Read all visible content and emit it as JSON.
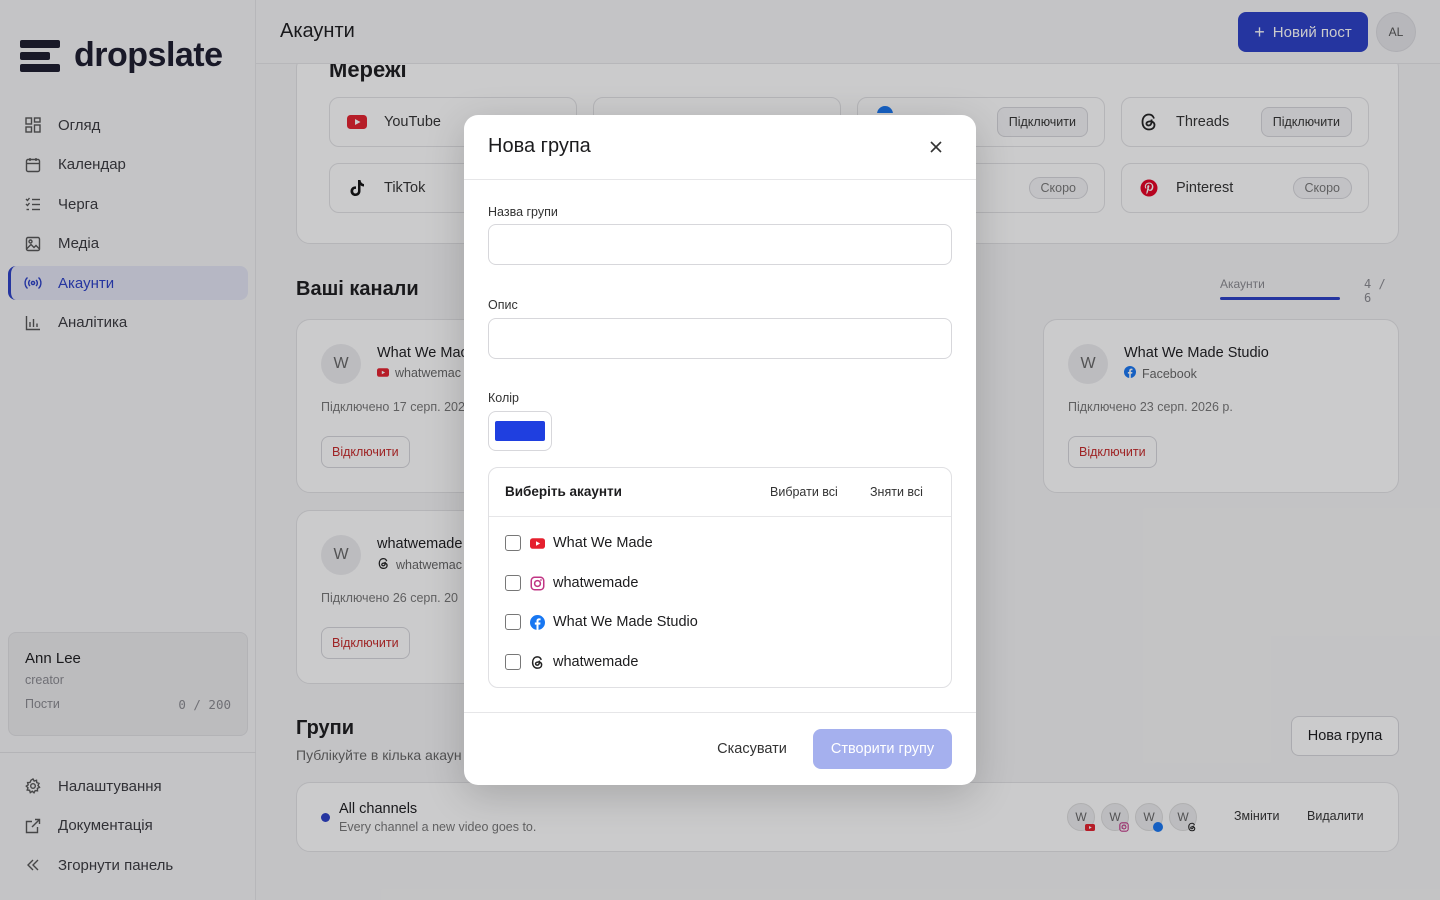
{
  "app": {
    "name": "dropslate"
  },
  "sidebar": {
    "items": [
      {
        "label": "Огляд",
        "icon": "grid-icon"
      },
      {
        "label": "Календар",
        "icon": "calendar-icon"
      },
      {
        "label": "Черга",
        "icon": "list-icon"
      },
      {
        "label": "Медіа",
        "icon": "image-icon"
      },
      {
        "label": "Акаунти",
        "icon": "broadcast-icon",
        "active": true
      },
      {
        "label": "Аналітика",
        "icon": "bar-chart-icon"
      }
    ],
    "user": {
      "name": "Ann Lee",
      "role": "creator",
      "posts_label": "Пости",
      "posts_count": "0 / 200"
    },
    "bottom": [
      {
        "label": "Налаштування",
        "icon": "gear-icon"
      },
      {
        "label": "Документація",
        "icon": "external-link-icon"
      },
      {
        "label": "Згорнути панель",
        "icon": "chevrons-left-icon"
      }
    ]
  },
  "header": {
    "title": "Акаунти",
    "new_post": "Новий пост",
    "avatar": "AL"
  },
  "networks": {
    "title": "Мережі",
    "tiles": [
      {
        "name": "YouTube",
        "action": ""
      },
      {
        "name": "",
        "action": ""
      },
      {
        "name": "",
        "action": "Підключити"
      },
      {
        "name": "Threads",
        "action": "Підключити"
      },
      {
        "name": "TikTok",
        "action": ""
      },
      {
        "name": "",
        "action": "Скоро"
      },
      {
        "name": "Pinterest",
        "action": "Скоро"
      }
    ]
  },
  "channels": {
    "title": "Ваші канали",
    "tab_label": "Акаунти",
    "count": "4 / 6",
    "cards": [
      {
        "avatar": "W",
        "name": "What We Mac",
        "sub": "whatwemac",
        "date": "Підключено 17 серп. 202",
        "disconnect": "Відключити"
      },
      {
        "avatar": "W",
        "name": "What We Made Studio",
        "sub": "Facebook",
        "date": "Підключено 23 серп. 2026 р.",
        "disconnect": "Відключити"
      },
      {
        "avatar": "W",
        "name": "whatwemade",
        "sub": "whatwemac",
        "date": "Підключено 26 серп. 20",
        "disconnect": "Відключити"
      }
    ]
  },
  "groups": {
    "title": "Групи",
    "subtitle": "Публікуйте в кілька акаун",
    "new_group": "Нова група",
    "items": [
      {
        "name": "All channels",
        "description": "Every channel a new video goes to.",
        "avatar": "W",
        "edit": "Змінити",
        "delete": "Видалити"
      }
    ]
  },
  "modal": {
    "title": "Нова група",
    "name_label": "Назва групи",
    "name_value": "",
    "desc_label": "Опис",
    "desc_value": "",
    "color_label": "Колір",
    "color_value": "#1f3fe0",
    "accounts_title": "Виберіть акаунти",
    "select_all": "Вибрати всі",
    "deselect_all": "Зняти всі",
    "accounts": [
      {
        "name": "What We Made",
        "platform": "youtube-icon"
      },
      {
        "name": "whatwemade",
        "platform": "instagram-icon"
      },
      {
        "name": "What We Made Studio",
        "platform": "facebook-icon"
      },
      {
        "name": "whatwemade",
        "platform": "threads-icon"
      }
    ],
    "cancel": "Скасувати",
    "create": "Створити групу"
  },
  "colors": {
    "accent": "#2b3fc7",
    "danger": "#c62828",
    "youtube": "#e5202e",
    "instagram": "#c13584",
    "facebook": "#1877f2",
    "pinterest": "#e60023"
  }
}
